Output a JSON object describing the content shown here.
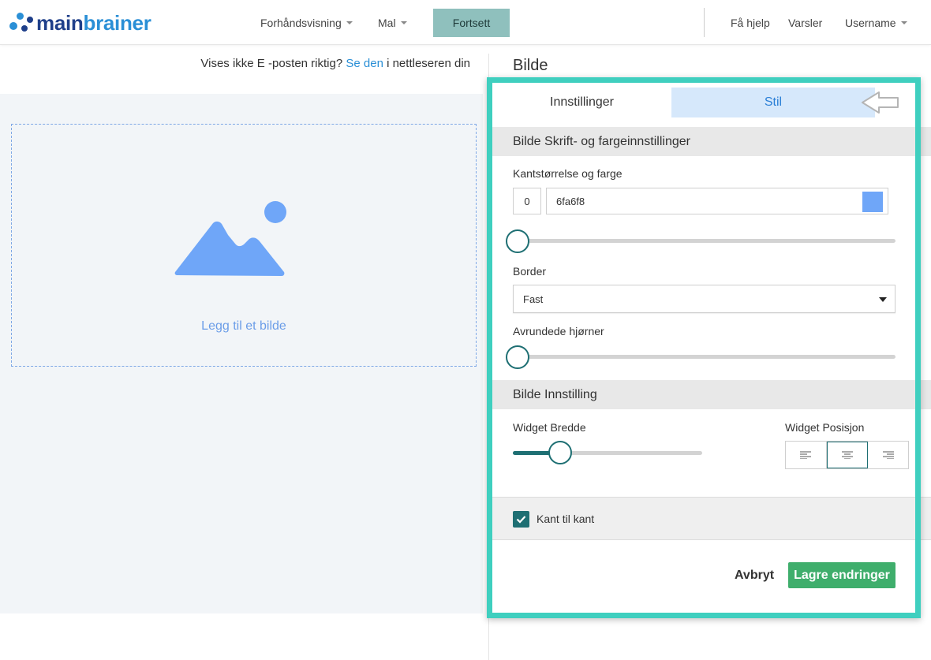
{
  "header": {
    "logo": {
      "part_a": "main",
      "part_b": "brainer"
    },
    "nav": {
      "preview": "Forhåndsvisning",
      "template": "Mal",
      "continue": "Fortsett"
    },
    "right": {
      "help": "Få hjelp",
      "alerts": "Varsler",
      "user": "Username"
    }
  },
  "preview": {
    "message_before": "Vises ikke E -posten riktig? ",
    "message_link": "Se den",
    "message_after": " i nettleseren din",
    "add_image": "Legg til et bilde"
  },
  "panel": {
    "title": "Bilde",
    "tabs": [
      {
        "label": "Innstillinger"
      },
      {
        "label": "Stil",
        "active": true
      }
    ],
    "section_style": {
      "heading": "Bilde Skrift- og fargeinnstillinger",
      "border_size_label": "Kantstørrelse og farge",
      "border_size_value": "0",
      "border_color_value": "6fa6f8",
      "border_size_slider": 0,
      "border_label": "Border",
      "border_value": "Fast",
      "rounded_label": "Avrundede hjørner",
      "rounded_slider": 0
    },
    "section_image": {
      "heading": "Bilde Innstilling",
      "width_label": "Widget Bredde",
      "width_slider": 0.25,
      "position_label": "Widget Posisjon",
      "position_options": [
        "left",
        "center",
        "right"
      ],
      "position_selected": "center"
    },
    "edge_to_edge": {
      "label": "Kant til kant",
      "checked": true
    },
    "actions": {
      "cancel": "Avbryt",
      "save": "Lagre endringer"
    }
  },
  "colors": {
    "accent": "#1e6f73",
    "highlight_frame": "#3fcfbf",
    "save_button": "#3fae6c",
    "continue_button": "#8fc0bd",
    "image_placeholder": "#6fa6f8",
    "active_tab_bg": "#d6e8fb"
  }
}
